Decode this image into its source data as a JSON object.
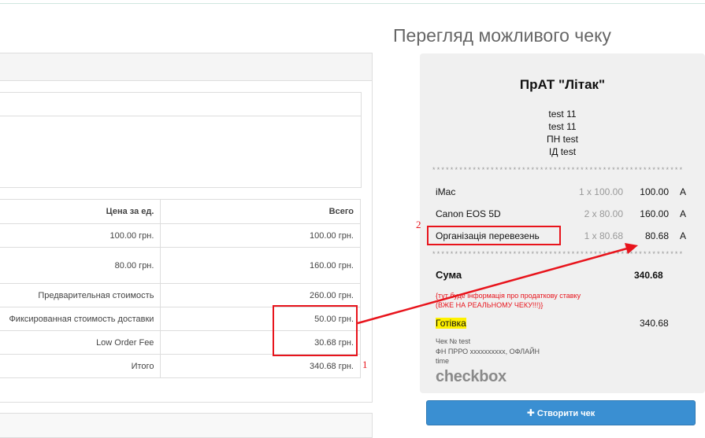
{
  "preview": {
    "title": "Перегляд можливого чеку"
  },
  "order_totals": {
    "header": {
      "unit_price": "Цена за ед.",
      "total": "Всего"
    },
    "rows": [
      {
        "unit_price": "100.00 грн.",
        "total": "100.00 грн."
      },
      {
        "unit_price": "80.00 грн.",
        "total": "160.00 грн."
      },
      {
        "unit_price": "Предварительная стоимость",
        "total": "260.00 грн."
      },
      {
        "unit_price": "Фиксированная стоимость доставки",
        "total": "50.00 грн."
      },
      {
        "unit_price": "Low Order Fee",
        "total": "30.68 грн."
      },
      {
        "unit_price": "Итого",
        "total": "340.68 грн."
      }
    ]
  },
  "annotations": {
    "label_1": "1",
    "label_2": "2",
    "color": "#e8141c"
  },
  "receipt": {
    "company": "ПрАТ \"Літак\"",
    "info_lines": [
      "test 11",
      "test 11",
      "ПН test",
      "ІД test"
    ],
    "separator": "********************************************************",
    "items": [
      {
        "name": "iMac",
        "qty": "1 x 100.00",
        "sum": "100.00",
        "tax": "А"
      },
      {
        "name": "Canon EOS 5D",
        "qty": "2 x 80.00",
        "sum": "160.00",
        "tax": "А"
      },
      {
        "name": "Організація перевезень",
        "qty": "1 x 80.68",
        "sum": "80.68",
        "tax": "А"
      }
    ],
    "sum_label": "Сума",
    "sum_value": "340.68",
    "tax_note_1": "{тут буде інформація про продаткову ставку",
    "tax_note_2": "(ВЖЕ НА РЕАЛЬНОМУ ЧЕКУ!!!)}",
    "payment_label": "Готівка",
    "payment_value": "340.68",
    "check_no": "Чек № test",
    "fn": "ФН ПРРО xxxxxxxxxx, ОФЛАЙН",
    "time": "time",
    "logo": "checkbox"
  },
  "create_button": {
    "icon": "plus-icon",
    "label": "Створити чек",
    "color": "#3a8fd2"
  }
}
